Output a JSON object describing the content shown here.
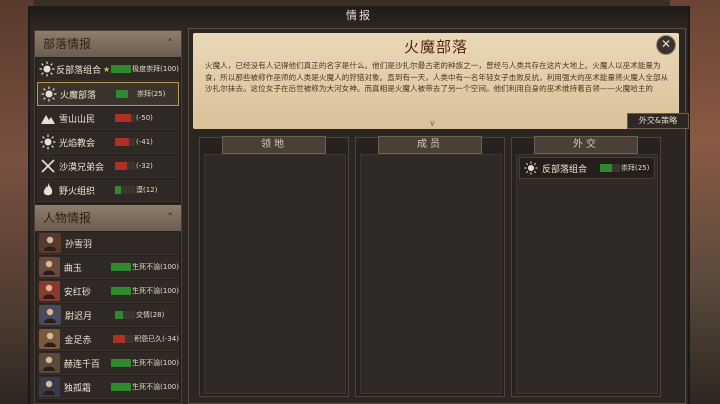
{
  "window": {
    "title": "情报"
  },
  "left": {
    "tribes_header": "部落情报",
    "tribes": [
      {
        "name": "反部落组合",
        "star": "★",
        "relation": "极度崇拜(100)",
        "bar_color": "#6a3a30",
        "fill": 1.0,
        "fill_color": "#2f8a2e",
        "icon": "sun-icon",
        "selected": false
      },
      {
        "name": "火魔部落",
        "star": "",
        "relation": "崇拜(25)",
        "bar_color": "#3a3530",
        "fill": 0.6,
        "fill_color": "#2f8a2e",
        "icon": "sun-icon",
        "selected": true
      },
      {
        "name": "雪山山民",
        "star": "",
        "relation": "(-50)",
        "bar_color": "#3a3530",
        "fill": 0.8,
        "fill_color": "#b03024",
        "icon": "mountain-icon",
        "selected": false
      },
      {
        "name": "光焰教会",
        "star": "",
        "relation": "(-41)",
        "bar_color": "#3a3530",
        "fill": 0.7,
        "fill_color": "#b03024",
        "icon": "sun-icon",
        "selected": false
      },
      {
        "name": "沙漠兄弟会",
        "star": "",
        "relation": "(-32)",
        "bar_color": "#3a3530",
        "fill": 0.6,
        "fill_color": "#b03024",
        "icon": "swords-icon",
        "selected": false
      },
      {
        "name": "野火组织",
        "star": "",
        "relation": "漠(12)",
        "bar_color": "#3a3530",
        "fill": 0.3,
        "fill_color": "#2f8a2e",
        "icon": "flame-icon",
        "selected": false
      }
    ],
    "chars_header": "人物情报",
    "chars": [
      {
        "name": "孙雪羽",
        "relation": "",
        "fill": 0,
        "fill_color": "#2f8a2e",
        "avatar_color": "#5a3a2c"
      },
      {
        "name": "曲玉",
        "relation": "生死不渝(100)",
        "fill": 1.0,
        "fill_color": "#2f8a2e",
        "avatar_color": "#6a4a3c"
      },
      {
        "name": "安红砂",
        "relation": "生死不渝(100)",
        "fill": 1.0,
        "fill_color": "#2f8a2e",
        "avatar_color": "#8a3a2c"
      },
      {
        "name": "尉迟月",
        "relation": "交情(28)",
        "fill": 0.4,
        "fill_color": "#2f8a2e",
        "avatar_color": "#4a4a5a"
      },
      {
        "name": "金足赤",
        "relation": "积怨已久(-34)",
        "fill": 0.6,
        "fill_color": "#b03024",
        "avatar_color": "#7a5a3c"
      },
      {
        "name": "赫连千百",
        "relation": "生死不渝(100)",
        "fill": 1.0,
        "fill_color": "#2f8a2e",
        "avatar_color": "#5a4a3c"
      },
      {
        "name": "独孤霜",
        "relation": "生死不渝(100)",
        "fill": 1.0,
        "fill_color": "#2f8a2e",
        "avatar_color": "#3a3a4a"
      }
    ]
  },
  "right": {
    "title": "火魔部落",
    "description": "火魔人，已经没有人记得他们真正的名字是什么。他们是沙扎尔最古老的种族之一，曾经与人类共存在这片大地上。火魔人以巫术能量为食，所以那些被称作巫师的人类是火魔人的狩猎对象。直到有一天，人类中有一名年轻女子击败反抗，利用强大的巫术能量将火魔人全部从沙扎尔抹去。这位女子在后世被称为大河女神。而真相是火魔人被带去了另一个空间。他们利用自身的巫术维持着百领——火魔哈主的",
    "more_icon": "chevron-down-icon",
    "close_icon": "close-icon",
    "diplomacy_button": "外交&策略",
    "columns": [
      {
        "header": "领地",
        "items": []
      },
      {
        "header": "成员",
        "items": []
      },
      {
        "header": "外交",
        "items": [
          {
            "name": "反部落组合",
            "relation": "崇拜(25)",
            "fill": 0.6,
            "fill_color": "#2f8a2e"
          }
        ]
      }
    ]
  }
}
